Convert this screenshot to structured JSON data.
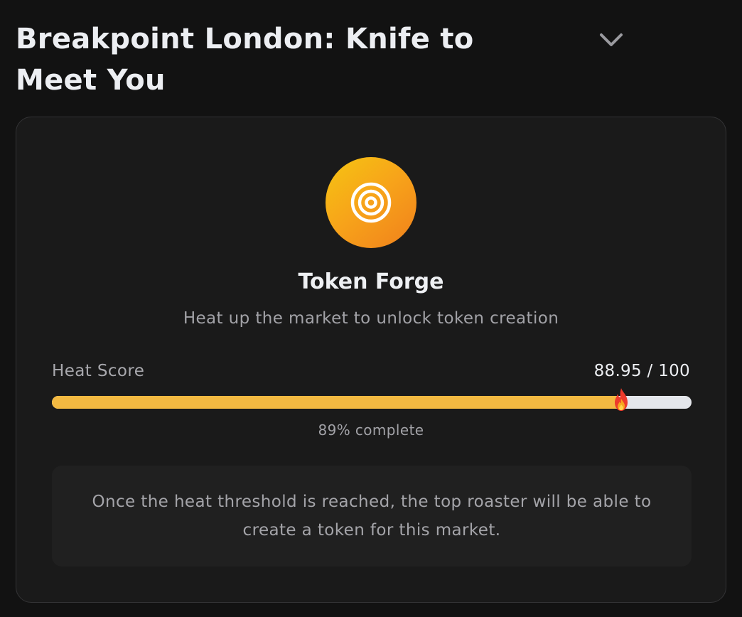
{
  "header": {
    "title": "Breakpoint London: Knife to Meet You",
    "toggle_icon": "chevron-down-icon"
  },
  "forge": {
    "icon": "target-icon",
    "icon_gradient": [
      "#f6c512",
      "#f0801c"
    ],
    "title": "Token Forge",
    "subtitle": "Heat up the market to unlock token creation"
  },
  "heat": {
    "label": "Heat Score",
    "value_text": "88.95 / 100",
    "score": 88.95,
    "max": 100,
    "fill_color": "#f3b941",
    "track_color": "#e4e6eb",
    "marker_icon": "flame-icon",
    "complete_text": "89% complete"
  },
  "note": {
    "text": "Once the heat threshold is reached, the top roaster will be able to create a token for this market."
  }
}
